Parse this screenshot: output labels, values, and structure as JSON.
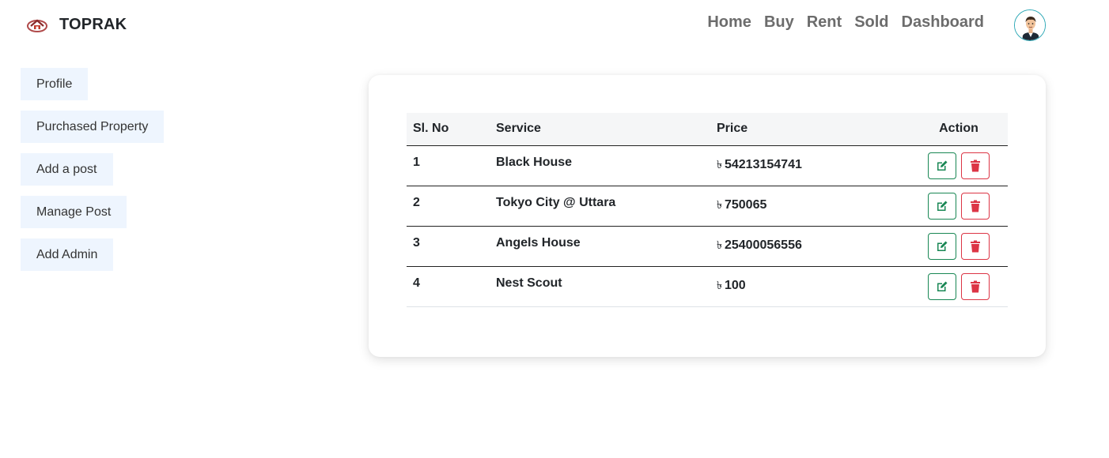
{
  "brand": {
    "name": "TOPRAK",
    "logo_icon": "house-logo-icon"
  },
  "nav": {
    "links": [
      "Home",
      "Buy",
      "Rent",
      "Sold",
      "Dashboard"
    ],
    "avatar_icon": "user-avatar-icon"
  },
  "sidebar": {
    "items": [
      {
        "label": "Profile"
      },
      {
        "label": "Purchased Property"
      },
      {
        "label": "Add a post"
      },
      {
        "label": "Manage Post"
      },
      {
        "label": "Add Admin"
      }
    ]
  },
  "table": {
    "headers": [
      "Sl. No",
      "Service",
      "Price",
      "Action"
    ],
    "currency_symbol": "৳",
    "rows": [
      {
        "sl": "1",
        "service": "Black House",
        "price": "54213154741"
      },
      {
        "sl": "2",
        "service": "Tokyo City @ Uttara",
        "price": "750065"
      },
      {
        "sl": "3",
        "service": "Angels House",
        "price": "25400056556"
      },
      {
        "sl": "4",
        "service": "Nest Scout",
        "price": "100"
      }
    ],
    "edit_icon": "edit-icon",
    "delete_icon": "trash-icon"
  },
  "colors": {
    "edit": "#198754",
    "delete": "#dc3545",
    "sidebar_bg": "#eef5fe",
    "nav_text": "#6c6c6c"
  }
}
